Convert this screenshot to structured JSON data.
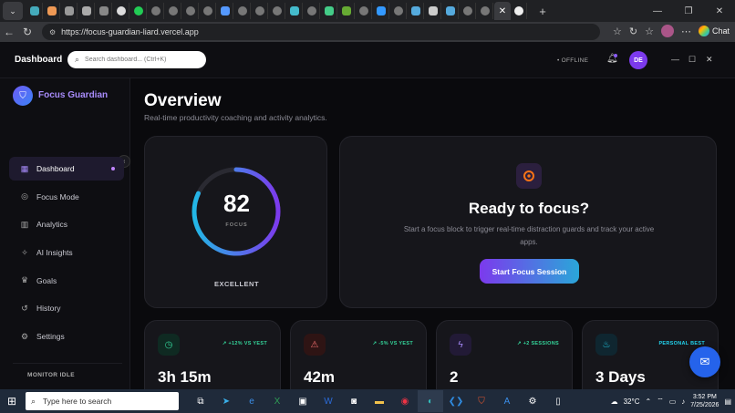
{
  "browser": {
    "url": "https://focus-guardian-liard.vercel.app",
    "chat_label": "Chat"
  },
  "app": {
    "header_title": "Dashboard",
    "search_placeholder": "Search dashboard... (Ctrl+K)",
    "status": "• OFFLINE",
    "user_initials": "DE",
    "brand": "Focus Guardian"
  },
  "sidebar": {
    "items": [
      {
        "label": "Dashboard",
        "icon": "grid-icon"
      },
      {
        "label": "Focus Mode",
        "icon": "target-icon"
      },
      {
        "label": "Analytics",
        "icon": "chart-icon"
      },
      {
        "label": "AI Insights",
        "icon": "sparkle-icon"
      },
      {
        "label": "Goals",
        "icon": "trophy-icon"
      },
      {
        "label": "History",
        "icon": "history-icon"
      },
      {
        "label": "Settings",
        "icon": "gear-icon"
      }
    ],
    "monitor_status": "MONITOR IDLE"
  },
  "overview": {
    "title": "Overview",
    "subtitle": "Real-time productivity coaching and activity analytics.",
    "focus_score": "82",
    "focus_label": "FOCUS",
    "focus_fraction": 0.82,
    "focus_rating": "EXCELLENT",
    "ready_title": "Ready to focus?",
    "ready_desc": "Start a focus block to trigger real-time distraction guards and track your active apps.",
    "start_button": "Start Focus Session"
  },
  "stats": [
    {
      "trend": "↗ +12% VS YEST",
      "value": "3h 15m",
      "icon": "clock-icon",
      "color": "#34d399"
    },
    {
      "trend": "↗ -5% VS YEST",
      "value": "42m",
      "icon": "alert-icon",
      "color": "#f87171"
    },
    {
      "trend": "↗ +2 SESSIONS",
      "value": "2",
      "icon": "bolt-icon",
      "color": "#a78bfa"
    },
    {
      "trend": "PERSONAL BEST",
      "value": "3 Days",
      "icon": "flame-icon",
      "color": "#22d3ee"
    }
  ],
  "taskbar": {
    "search_placeholder": "Type here to search",
    "temperature": "32°C",
    "time": "3:52 PM",
    "date": "7/25/2026"
  },
  "colors": {
    "accent": "#7c3aed",
    "accent_cyan": "#2aa6d9",
    "background": "#0a0a0d",
    "card": "#16161b"
  }
}
